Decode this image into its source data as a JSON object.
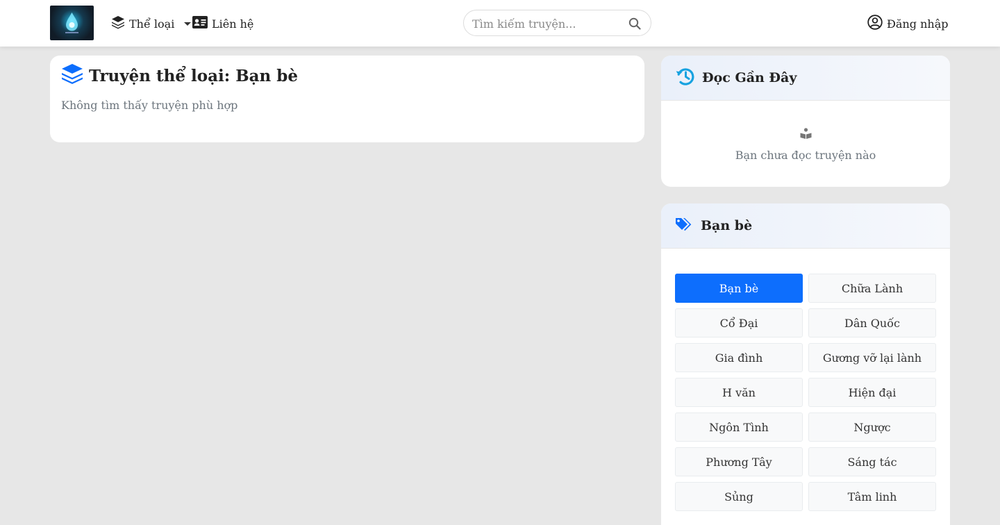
{
  "nav": {
    "genre_label": "Thể loại",
    "contact_label": "Liên hệ",
    "search_placeholder": "Tìm kiếm truyện...",
    "login_label": "Đăng nhập"
  },
  "main": {
    "title": "Truyện thể loại: Bạn bè",
    "empty_message": "Không tìm thấy truyện phù hợp"
  },
  "recent": {
    "title": "Đọc Gần Đây",
    "empty_message": "Bạn chưa đọc truyện nào"
  },
  "tags": {
    "title": "Bạn bè",
    "items": [
      {
        "label": "Bạn bè",
        "active": true
      },
      {
        "label": "Chữa Lành"
      },
      {
        "label": "Cổ Đại"
      },
      {
        "label": "Dân Quốc"
      },
      {
        "label": "Gia đình"
      },
      {
        "label": "Gương vỡ lại lành"
      },
      {
        "label": "H văn"
      },
      {
        "label": "Hiện đại"
      },
      {
        "label": "Ngôn Tình"
      },
      {
        "label": "Ngược"
      },
      {
        "label": "Phương Tây"
      },
      {
        "label": "Sáng tác"
      },
      {
        "label": "Sủng"
      },
      {
        "label": "Tâm linh"
      }
    ]
  },
  "colors": {
    "accent": "#0d6efd",
    "history_icon": "#17a2e0",
    "page_bg": "#e7e7e7"
  }
}
